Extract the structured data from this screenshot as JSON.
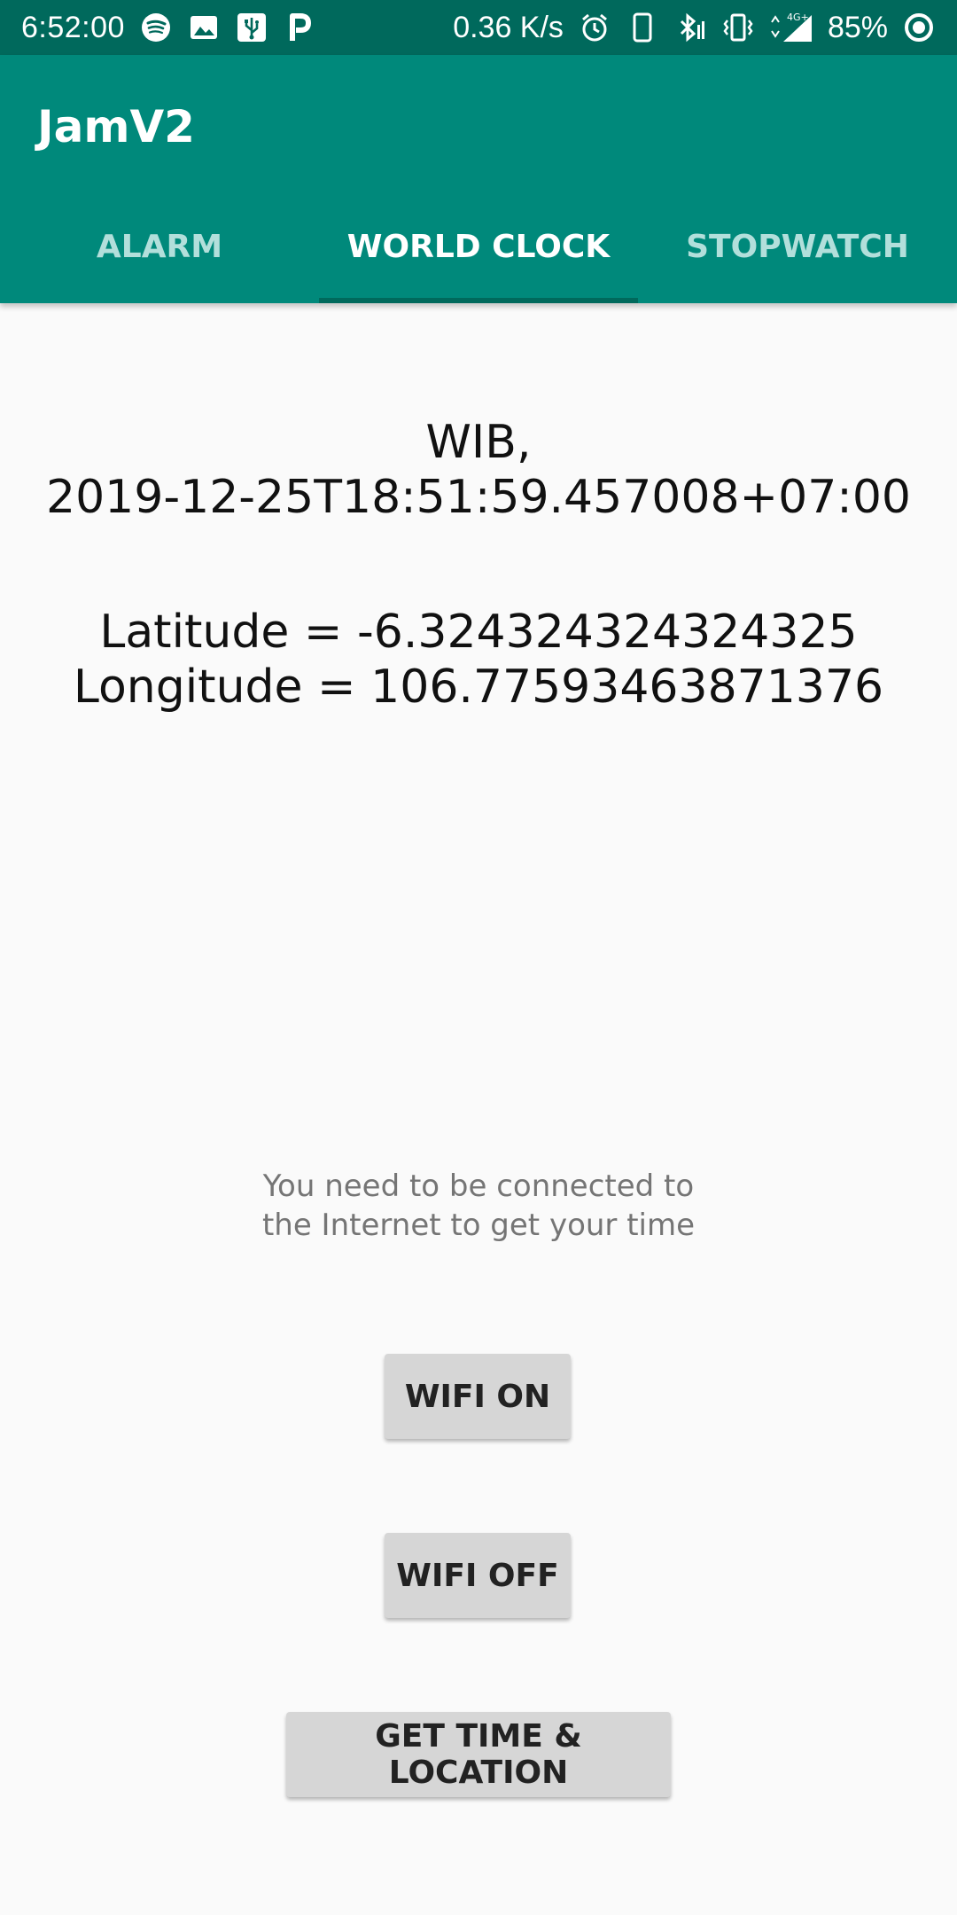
{
  "status_bar": {
    "time": "6:52:00",
    "network_speed": "0.36 K/s",
    "network_type": "4G+",
    "battery": "85%",
    "left_icons": [
      "spotify-icon",
      "image-icon",
      "usb-icon",
      "parking-icon"
    ],
    "right_icons": [
      "alarm-icon",
      "phone-icon",
      "bluetooth-icon",
      "vibrate-icon",
      "signal-icon",
      "battery-saver-icon"
    ]
  },
  "app_bar": {
    "title": "JamV2",
    "color": "#00897b",
    "status_color": "#00695c"
  },
  "tabs": [
    {
      "label": "ALARM",
      "active": false
    },
    {
      "label": "WORLD CLOCK",
      "active": true
    },
    {
      "label": "STOPWATCH",
      "active": false
    }
  ],
  "world_clock": {
    "zone_line": "WIB,",
    "datetime_line": "2019-12-25T18:51:59.457008+07:00",
    "latitude_line": "Latitude = -6.324324324324325",
    "longitude_line": "Longitude = 106.77593463871376",
    "notice_line1": "You need to be connected to",
    "notice_line2": "the Internet to get your time"
  },
  "buttons": {
    "wifi_on": "WIFI ON",
    "wifi_off": "WIFI OFF",
    "get_time_location": "GET TIME & LOCATION"
  }
}
